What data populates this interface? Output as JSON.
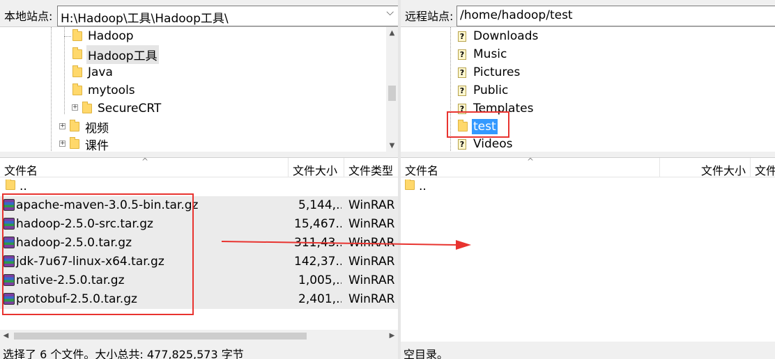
{
  "local": {
    "site_label": "本地站点:",
    "site_path": "H:\\Hadoop\\工具\\Hadoop工具\\",
    "tree": [
      "Hadoop",
      "Hadoop工具",
      "Java",
      "mytools",
      "SecureCRT",
      "视频",
      "课件"
    ],
    "columns": {
      "name": "文件名",
      "size": "文件大小",
      "type": "文件类型"
    },
    "parent_dir": "..",
    "files": [
      {
        "name": "apache-maven-3.0.5-bin.tar.gz",
        "size": "5,144,...",
        "type": "WinRAR"
      },
      {
        "name": "hadoop-2.5.0-src.tar.gz",
        "size": "15,467...",
        "type": "WinRAR"
      },
      {
        "name": "hadoop-2.5.0.tar.gz",
        "size": "311,43...",
        "type": "WinRAR"
      },
      {
        "name": "jdk-7u67-linux-x64.tar.gz",
        "size": "142,37...",
        "type": "WinRAR"
      },
      {
        "name": "native-2.5.0.tar.gz",
        "size": "1,005,...",
        "type": "WinRAR"
      },
      {
        "name": "protobuf-2.5.0.tar.gz",
        "size": "2,401,...",
        "type": "WinRAR"
      }
    ],
    "status": "选择了 6 个文件。大小总共: 477,825,573 字节"
  },
  "remote": {
    "site_label": "远程站点:",
    "site_path": "/home/hadoop/test",
    "tree": [
      "Downloads",
      "Music",
      "Pictures",
      "Public",
      "Templates",
      "test",
      "Videos"
    ],
    "columns": {
      "name": "文件名",
      "size": "文件大小",
      "type": "文件"
    },
    "parent_dir": "..",
    "status": "空目录。"
  },
  "colors": {
    "highlight": "#e8332f",
    "selection": "#3399ff"
  }
}
